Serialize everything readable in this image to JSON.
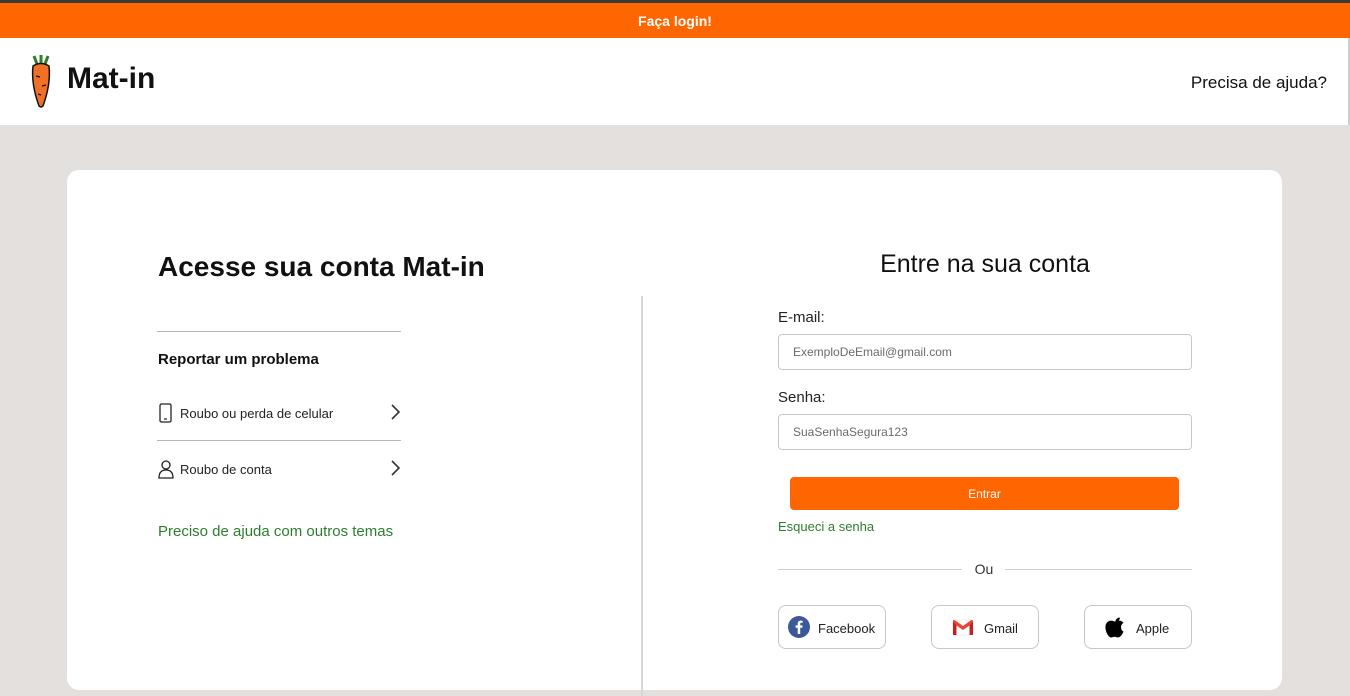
{
  "banner": {
    "text": "Faça login!"
  },
  "header": {
    "logo_text": "Mat-in",
    "help_link": "Precisa de ajuda?"
  },
  "left": {
    "title": "Acesse sua conta Mat-in",
    "report_title": "Reportar um problema",
    "items": [
      {
        "label": "Roubo ou perda de celular",
        "icon": "phone-icon"
      },
      {
        "label": "Roubo de conta",
        "icon": "user-icon"
      }
    ],
    "other_help": "Preciso de ajuda com outros temas"
  },
  "login": {
    "title": "Entre na sua conta",
    "email_label": "E-mail:",
    "email_placeholder": "ExemploDeEmail@gmail.com",
    "password_label": "Senha:",
    "password_placeholder": "SuaSenhaSegura123",
    "submit_label": "Entrar",
    "forgot_label": "Esqueci a senha",
    "or_label": "Ou",
    "social": [
      {
        "label": "Facebook",
        "icon": "facebook-icon"
      },
      {
        "label": "Gmail",
        "icon": "gmail-icon"
      },
      {
        "label": "Apple",
        "icon": "apple-icon"
      }
    ]
  },
  "colors": {
    "accent": "#ff6600",
    "link_green": "#2e7d2e",
    "background": "#e3e0de"
  }
}
